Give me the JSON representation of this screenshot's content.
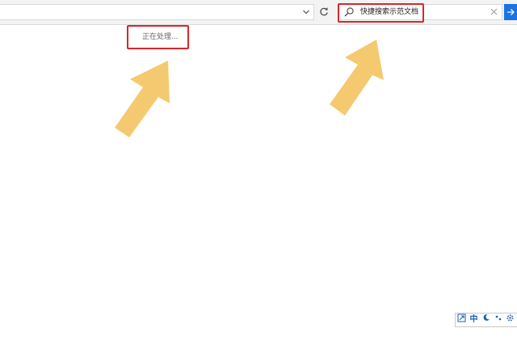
{
  "search": {
    "value": "快捷搜索示范文档"
  },
  "status": {
    "text": "正在处理..."
  },
  "icons": {
    "address_dropdown": "chevron-down-icon",
    "refresh": "refresh-icon",
    "search": "search-icon",
    "clear": "close-icon",
    "go": "arrow-right-icon"
  },
  "ime": {
    "mode_label": "中"
  },
  "colors": {
    "highlight": "#d8262a",
    "arrow": "#f5c970",
    "accent": "#1a73e8"
  }
}
